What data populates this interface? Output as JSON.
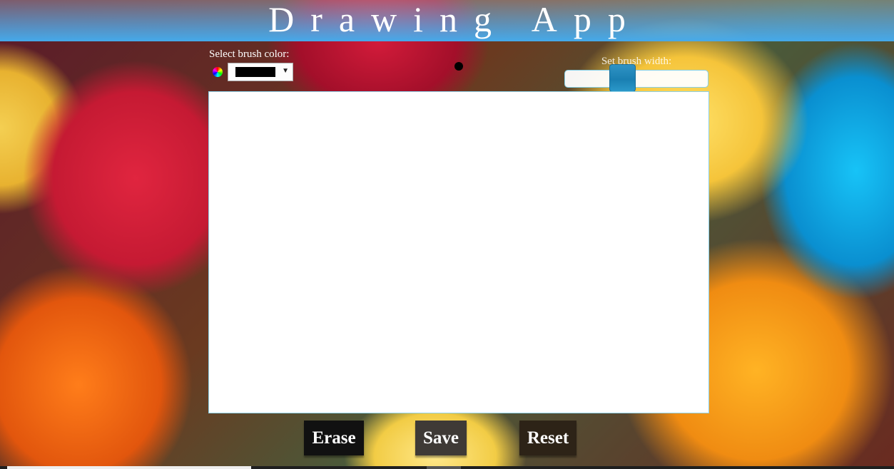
{
  "header": {
    "title": "Drawing App"
  },
  "color_picker": {
    "label": "Select brush color:",
    "icon": "color-wheel-icon",
    "selected_color": "#000000"
  },
  "brush_preview": {
    "color": "#000000"
  },
  "width_picker": {
    "label": "Set brush width:",
    "value_fraction": 0.37
  },
  "buttons": {
    "erase": "Erase",
    "save": "Save",
    "reset": "Reset"
  },
  "colors": {
    "header_blue": "#45a9ea",
    "slider_handle": "#1a7fb2",
    "canvas_border": "#8ccfe6"
  }
}
